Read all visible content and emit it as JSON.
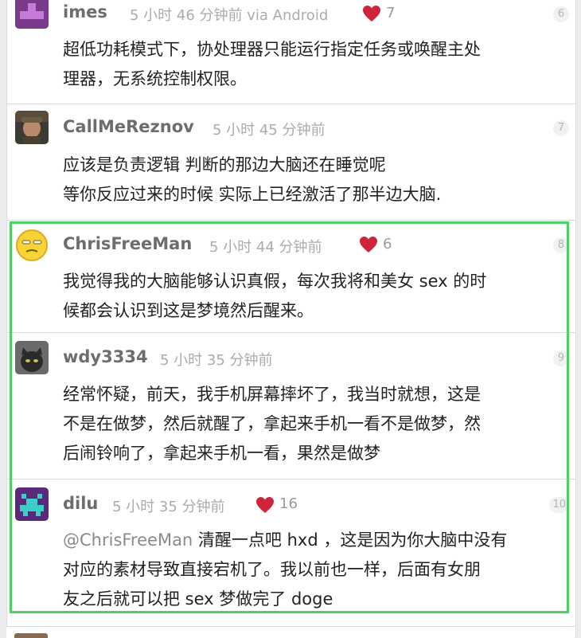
{
  "comments": [
    {
      "user": "imes",
      "time": "5 小时 46 分钟前 via Android",
      "likes": "7",
      "floor": "6",
      "lines": [
        "超低功耗模式下，协处理器只能运行指定任务或唤醒主处",
        "理器，无系统控制权限。"
      ]
    },
    {
      "user": "CallMeReznov",
      "time": "5 小时 45 分钟前",
      "floor": "7",
      "lines": [
        "应该是负责逻辑 判断的那边大脑还在睡觉呢",
        "等你反应过来的时候 实际上已经激活了那半边大脑."
      ]
    },
    {
      "user": "ChrisFreeMan",
      "time": "5 小时 44 分钟前",
      "likes": "6",
      "floor": "8",
      "lines": [
        "我觉得我的大脑能够认识真假，每次我将和美女 sex 的时",
        "候都会认识到这是梦境然后醒来。"
      ]
    },
    {
      "user": "wdy3334",
      "time": "5 小时 35 分钟前",
      "floor": "9",
      "lines": [
        "经常怀疑，前天，我手机屏幕摔坏了，我当时就想，这是",
        "不是在做梦，然后就醒了，拿起来手机一看不是做梦，然",
        "后闹铃响了，拿起来手机一看，果然是做梦"
      ]
    },
    {
      "user": "dilu",
      "time": "5 小时 35 分钟前",
      "likes": "16",
      "floor": "10",
      "mention": "@ChrisFreeMan",
      "lines": [
        " 清醒一点吧 hxd ，这是因为你大脑中没有",
        "对应的素材导致直接宕机了。我以前也一样，后面有女朋",
        "友之后就可以把 sex 梦做完了 doge"
      ]
    }
  ],
  "colors": {
    "highlight": "#4cd264",
    "heart": "#d0243a",
    "username": "#6d6d6d",
    "time": "#ababab"
  },
  "icons": [
    "heart-icon"
  ]
}
